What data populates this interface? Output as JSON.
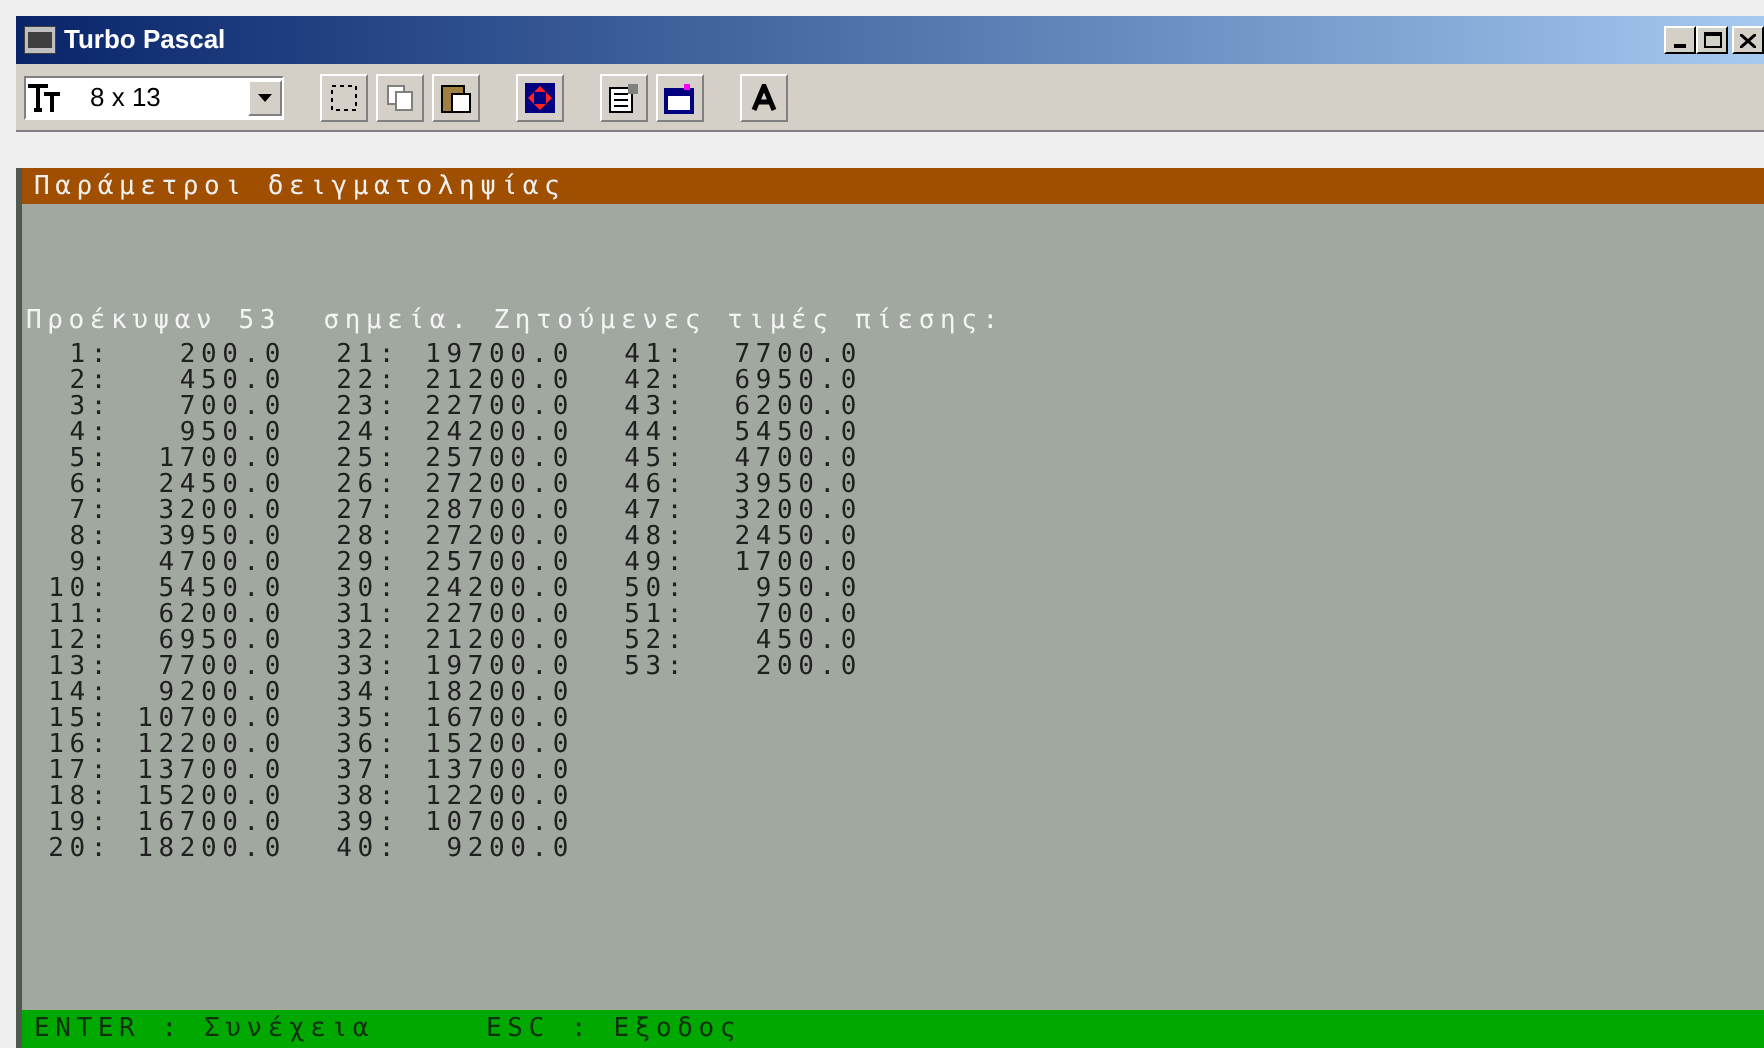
{
  "window": {
    "title": "Turbo Pascal"
  },
  "toolbar": {
    "font_size": "8 x 13"
  },
  "header_bar": "Παράμετροι δειγματοληψίας",
  "console": {
    "heading": "Προέκυψαν 53  σημεία. Ζητούμενες τιμές πίεσης:",
    "rows": [
      [
        {
          "index": "1:",
          "value": "200.0"
        },
        {
          "index": "21:",
          "value": "19700.0"
        },
        {
          "index": "41:",
          "value": "7700.0"
        }
      ],
      [
        {
          "index": "2:",
          "value": "450.0"
        },
        {
          "index": "22:",
          "value": "21200.0"
        },
        {
          "index": "42:",
          "value": "6950.0"
        }
      ],
      [
        {
          "index": "3:",
          "value": "700.0"
        },
        {
          "index": "23:",
          "value": "22700.0"
        },
        {
          "index": "43:",
          "value": "6200.0"
        }
      ],
      [
        {
          "index": "4:",
          "value": "950.0"
        },
        {
          "index": "24:",
          "value": "24200.0"
        },
        {
          "index": "44:",
          "value": "5450.0"
        }
      ],
      [
        {
          "index": "5:",
          "value": "1700.0"
        },
        {
          "index": "25:",
          "value": "25700.0"
        },
        {
          "index": "45:",
          "value": "4700.0"
        }
      ],
      [
        {
          "index": "6:",
          "value": "2450.0"
        },
        {
          "index": "26:",
          "value": "27200.0"
        },
        {
          "index": "46:",
          "value": "3950.0"
        }
      ],
      [
        {
          "index": "7:",
          "value": "3200.0"
        },
        {
          "index": "27:",
          "value": "28700.0"
        },
        {
          "index": "47:",
          "value": "3200.0"
        }
      ],
      [
        {
          "index": "8:",
          "value": "3950.0"
        },
        {
          "index": "28:",
          "value": "27200.0"
        },
        {
          "index": "48:",
          "value": "2450.0"
        }
      ],
      [
        {
          "index": "9:",
          "value": "4700.0"
        },
        {
          "index": "29:",
          "value": "25700.0"
        },
        {
          "index": "49:",
          "value": "1700.0"
        }
      ],
      [
        {
          "index": "10:",
          "value": "5450.0"
        },
        {
          "index": "30:",
          "value": "24200.0"
        },
        {
          "index": "50:",
          "value": "950.0"
        }
      ],
      [
        {
          "index": "11:",
          "value": "6200.0"
        },
        {
          "index": "31:",
          "value": "22700.0"
        },
        {
          "index": "51:",
          "value": "700.0"
        }
      ],
      [
        {
          "index": "12:",
          "value": "6950.0"
        },
        {
          "index": "32:",
          "value": "21200.0"
        },
        {
          "index": "52:",
          "value": "450.0"
        }
      ],
      [
        {
          "index": "13:",
          "value": "7700.0"
        },
        {
          "index": "33:",
          "value": "19700.0"
        },
        {
          "index": "53:",
          "value": "200.0"
        }
      ],
      [
        {
          "index": "14:",
          "value": "9200.0"
        },
        {
          "index": "34:",
          "value": "18200.0"
        }
      ],
      [
        {
          "index": "15:",
          "value": "10700.0"
        },
        {
          "index": "35:",
          "value": "16700.0"
        }
      ],
      [
        {
          "index": "16:",
          "value": "12200.0"
        },
        {
          "index": "36:",
          "value": "15200.0"
        }
      ],
      [
        {
          "index": "17:",
          "value": "13700.0"
        },
        {
          "index": "37:",
          "value": "13700.0"
        }
      ],
      [
        {
          "index": "18:",
          "value": "15200.0"
        },
        {
          "index": "38:",
          "value": "12200.0"
        }
      ],
      [
        {
          "index": "19:",
          "value": "16700.0"
        },
        {
          "index": "39:",
          "value": "10700.0"
        }
      ],
      [
        {
          "index": "20:",
          "value": "18200.0"
        },
        {
          "index": "40:",
          "value": "9200.0"
        }
      ]
    ]
  },
  "status_bar": [
    "ENTER : Συνέχεια",
    "ESC : Εξοδος"
  ]
}
